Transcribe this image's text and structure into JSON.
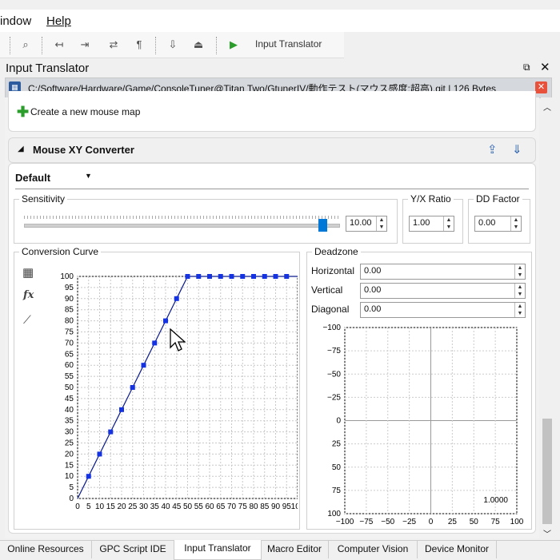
{
  "menu": {
    "window": "indow",
    "help": "Help"
  },
  "toolbar": {
    "run_label": "Input Translator"
  },
  "panel": {
    "title": "Input Translator",
    "path": "C:/Software/Hardware/Game/ConsoleTuner@Titan Two/GtunerIV/動作テスト(マウス感度:超高).git",
    "size": "126 Bytes"
  },
  "mouse_map": {
    "create_label": "Create a new mouse map"
  },
  "converter": {
    "title": "Mouse XY Converter",
    "preset": "Default",
    "sensitivity_label": "Sensitivity",
    "sensitivity_value": "10.00",
    "sensitivity_level": 0.95,
    "yx_ratio_label": "Y/X Ratio",
    "yx_ratio_value": "1.00",
    "dd_factor_label": "DD Factor",
    "dd_factor_value": "0.00",
    "curve_label": "Conversion Curve",
    "deadzone_label": "Deadzone",
    "horizontal_label": "Horizontal",
    "horizontal_value": "0.00",
    "vertical_label": "Vertical",
    "vertical_value": "0.00",
    "diagonal_label": "Diagonal",
    "diagonal_value": "0.00",
    "deadzone_readout": "1.0000"
  },
  "chart_data": [
    {
      "type": "line",
      "x": [
        0,
        5,
        10,
        15,
        20,
        25,
        30,
        35,
        40,
        45,
        50,
        55,
        60,
        65,
        70,
        75,
        80,
        85,
        90,
        95,
        100
      ],
      "series": [
        {
          "values": [
            0,
            10,
            20,
            30,
            40,
            50,
            60,
            70,
            80,
            90,
            100,
            100,
            100,
            100,
            100,
            100,
            100,
            100,
            100,
            100,
            100
          ]
        }
      ],
      "xticks": [
        "0",
        "5",
        "10",
        "15",
        "20",
        "25",
        "30",
        "35",
        "40",
        "45",
        "50",
        "55",
        "60",
        "65",
        "70",
        "75",
        "80",
        "85",
        "90",
        "95",
        "100"
      ],
      "yticks": [
        "100",
        "95",
        "90",
        "85",
        "80",
        "75",
        "70",
        "65",
        "60",
        "55",
        "50",
        "45",
        "40",
        "35",
        "30",
        "25",
        "20",
        "15",
        "10",
        "5",
        "0"
      ],
      "xlim": [
        0,
        100
      ],
      "ylim": [
        0,
        100
      ],
      "grid": true,
      "colors": {
        "line": "#0a1a8c",
        "point": "#1533e0",
        "marker": "#e01010"
      }
    },
    {
      "type": "scatter",
      "xticks": [
        "−100",
        "−75",
        "−50",
        "−25",
        "0",
        "25",
        "50",
        "75",
        "100"
      ],
      "yticks": [
        "−100",
        "−75",
        "−50",
        "−25",
        "0",
        "25",
        "50",
        "75",
        "100"
      ],
      "xlim": [
        -100,
        100
      ],
      "ylim": [
        -100,
        100
      ],
      "grid": true
    }
  ],
  "tabs": [
    {
      "label": "Online Resources"
    },
    {
      "label": "GPC Script IDE"
    },
    {
      "label": "Input Translator",
      "active": true
    },
    {
      "label": "Macro Editor"
    },
    {
      "label": "Computer Vision"
    },
    {
      "label": "Device Monitor"
    }
  ]
}
